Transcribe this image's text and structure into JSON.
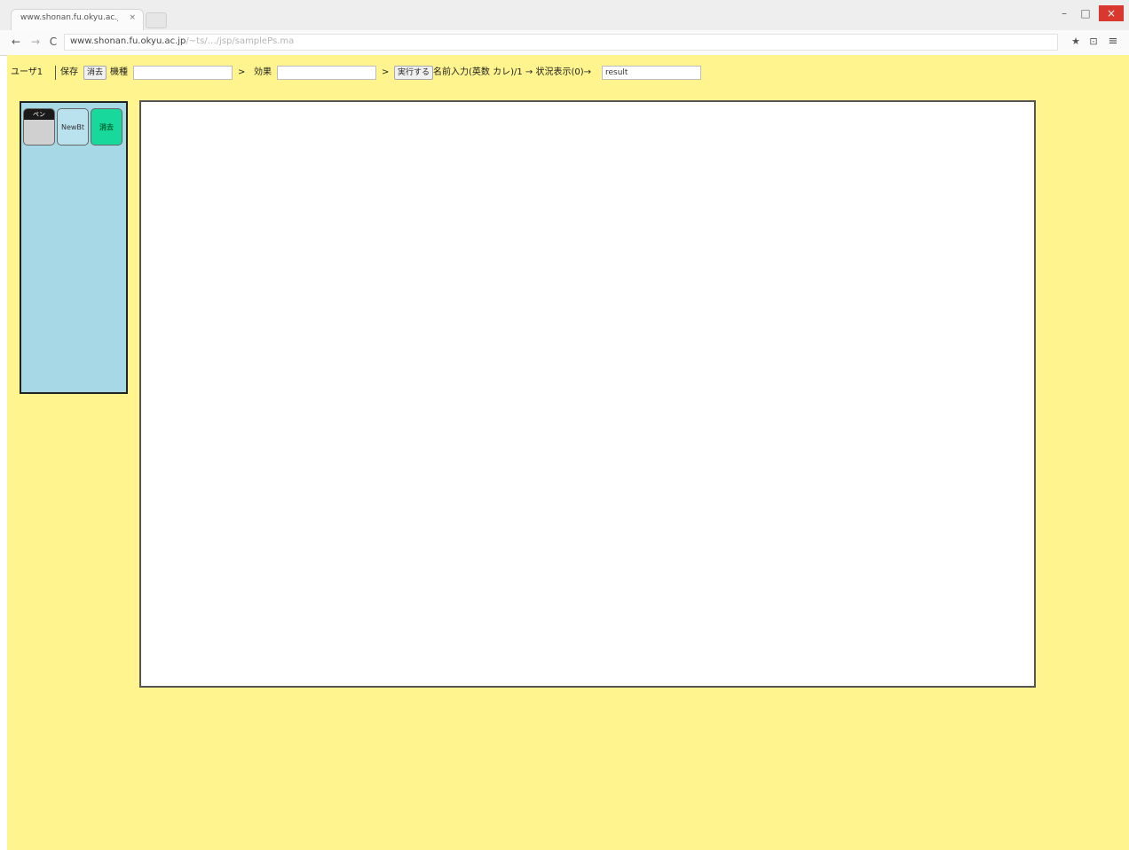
{
  "browser": {
    "tab_title": "www.shonan.fu.okyu.ac.jp...",
    "tab_close": "×",
    "window_controls": {
      "minimize": "–",
      "maximize": "□",
      "close": "×"
    },
    "nav": {
      "back": "←",
      "forward": "→",
      "reload": "C"
    },
    "url_main": "www.shonan.fu.okyu.ac.jp",
    "url_rest": "/~ts/…/jsp/samplePs.ma",
    "icons": {
      "star": "★",
      "extension": "⊡",
      "menu": "≡"
    }
  },
  "toolbar": {
    "user_label": "ユーザ1",
    "save_button": "保存",
    "clear_button": "消去",
    "content_label": "機種",
    "content_value": "",
    "content_go": ">",
    "sound_label": "効果",
    "sound_value": "",
    "sound_go": ">",
    "run_button": "実行する",
    "note_text": "名前入力(英数 カレ)/1 → 状況表示(0)→",
    "status_value": "result"
  },
  "palette": {
    "items": [
      {
        "label": "ペン",
        "name": "pen"
      },
      {
        "label": "NewBt",
        "name": "new"
      },
      {
        "label": "消去",
        "name": "erase"
      }
    ]
  },
  "colors": {
    "page_bg": "#fff48e",
    "palette_bg": "#a6d8e6",
    "erase_btn": "#18d89c"
  }
}
